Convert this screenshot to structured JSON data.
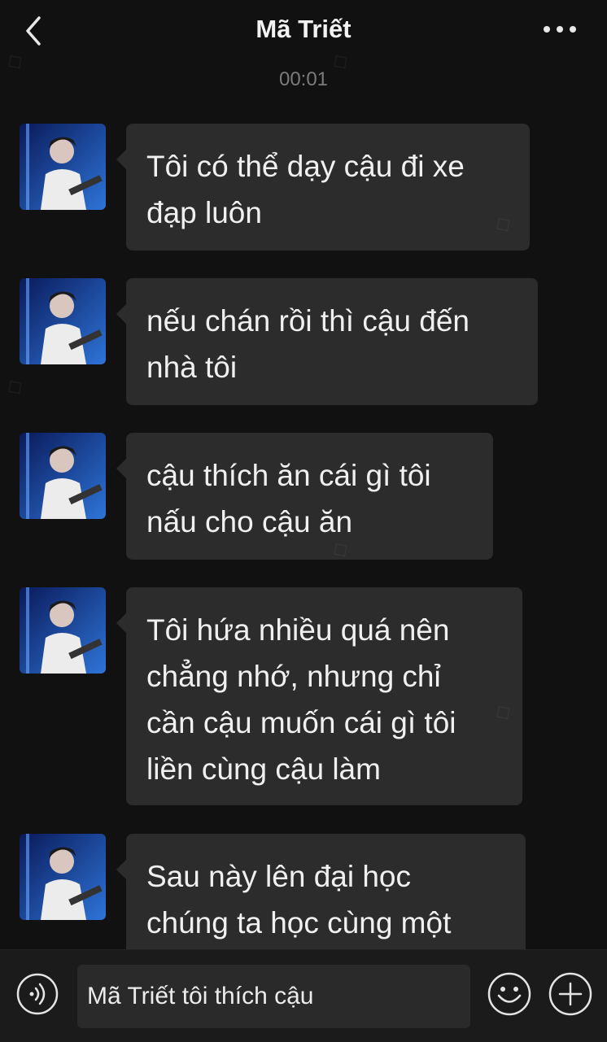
{
  "header": {
    "title": "Mã Triết",
    "back_icon": "chevron-left-icon",
    "more_icon": "more-horizontal-icon"
  },
  "chat": {
    "timestamp": "00:01",
    "messages": [
      {
        "sender": "Mã Triết",
        "text": "Tôi có thể dạy cậu đi xe\nđạp luôn"
      },
      {
        "sender": "Mã Triết",
        "text": "nếu chán rồi thì cậu đến\nnhà tôi"
      },
      {
        "sender": "Mã Triết",
        "text": "cậu thích ăn cái gì tôi\nnấu cho cậu ăn"
      },
      {
        "sender": "Mã Triết",
        "text": "Tôi hứa nhiều quá nên\nchẳng nhớ, nhưng chỉ\ncần cậu muốn cái gì tôi\nliền cùng cậu làm"
      },
      {
        "sender": "Mã Triết",
        "text": "Sau này lên đại học\nchúng ta học cùng một\n"
      }
    ]
  },
  "composer": {
    "value": "Mã Triết tôi thích cậu",
    "voice_icon": "voice-icon",
    "emoji_icon": "emoji-icon",
    "plus_icon": "plus-icon"
  },
  "colors": {
    "background": "#111111",
    "bubble": "#2c2c2c",
    "footer": "#1b1b1b",
    "text": "#f0f0f0",
    "timestamp": "#7b7b7b"
  }
}
